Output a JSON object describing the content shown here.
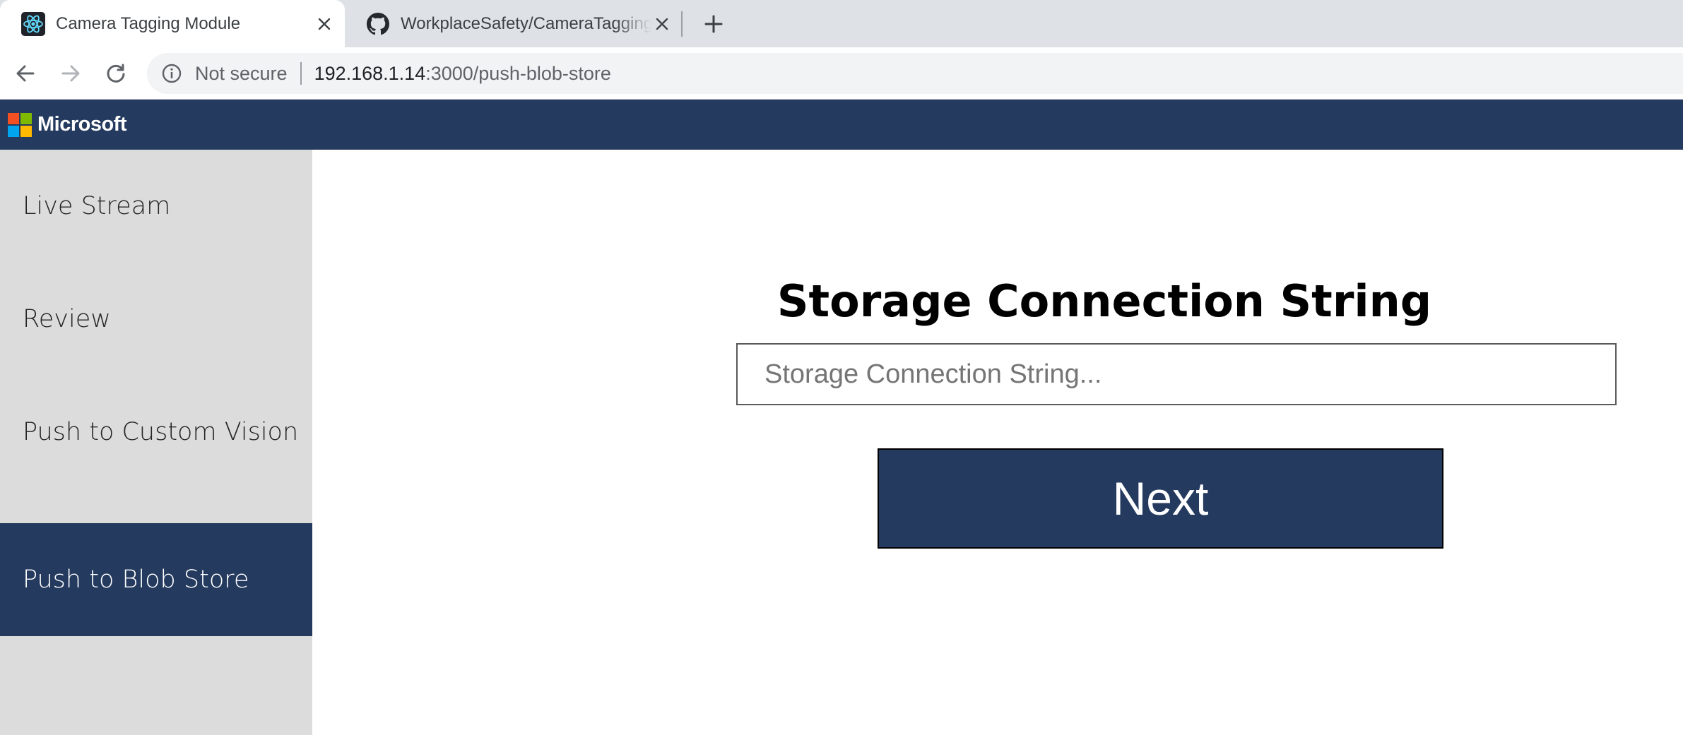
{
  "browser": {
    "tabs": [
      {
        "title": "Camera Tagging Module",
        "icon": "react-icon",
        "active": true
      },
      {
        "title": "WorkplaceSafety/CameraTagging",
        "icon": "github-icon",
        "active": false
      }
    ],
    "new_tab_icon": "plus-icon",
    "nav": {
      "back_icon": "back-arrow-icon",
      "forward_icon": "forward-arrow-icon",
      "reload_icon": "reload-icon"
    },
    "address_bar": {
      "security_icon": "info-icon",
      "security_label": "Not secure",
      "url_host": "192.168.1.14",
      "url_path": ":3000/push-blob-store"
    }
  },
  "app": {
    "brand": "Microsoft",
    "colors": {
      "header": "#243a5e",
      "sidebar": "#dcdcdc",
      "active_item": "#243a5e"
    },
    "sidebar": {
      "items": [
        {
          "label": "Live Stream",
          "active": false
        },
        {
          "label": "Review",
          "active": false
        },
        {
          "label": "Push to Custom Vision",
          "active": false
        },
        {
          "label": "Push to Blob Store",
          "active": true
        }
      ]
    },
    "main": {
      "title": "Storage Connection String",
      "input": {
        "placeholder": "Storage Connection String...",
        "value": ""
      },
      "next_label": "Next"
    }
  }
}
